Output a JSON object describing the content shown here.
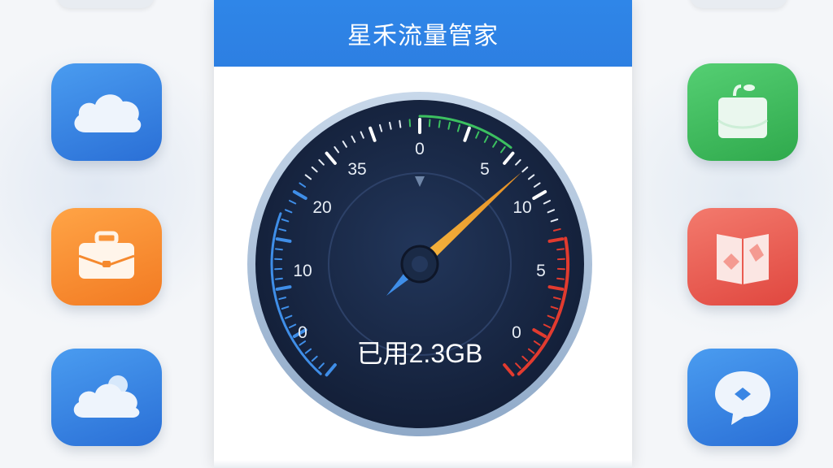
{
  "app": {
    "title": "星禾流量管家"
  },
  "gauge": {
    "usage_text": "已用2.3GB",
    "left_scale_labels": [
      "35",
      "20",
      "10",
      "0"
    ],
    "top_label": "0",
    "right_scale_labels": [
      "5",
      "10",
      "5",
      "0"
    ],
    "needle_value_label": "5",
    "colors": {
      "face": "#172541",
      "bezel": "#9fb9d6",
      "needle": "#f0a630",
      "needle_tail": "#3f8ee8",
      "scale_blue": "#3f8ee8",
      "scale_green": "#3cc060",
      "scale_red": "#e23b2f"
    }
  },
  "side_icons": {
    "left": [
      {
        "icon": "cloud-icon",
        "color": "#3a86e4"
      },
      {
        "icon": "briefcase-icon",
        "color": "#f5892e"
      },
      {
        "icon": "weather-cloud-icon",
        "color": "#3a86e4"
      }
    ],
    "right": [
      {
        "icon": "shopping-bag-icon",
        "color": "#3ebc5e"
      },
      {
        "icon": "map-book-icon",
        "color": "#ea5b50"
      },
      {
        "icon": "chat-bubble-icon",
        "color": "#3a86e4"
      }
    ]
  }
}
